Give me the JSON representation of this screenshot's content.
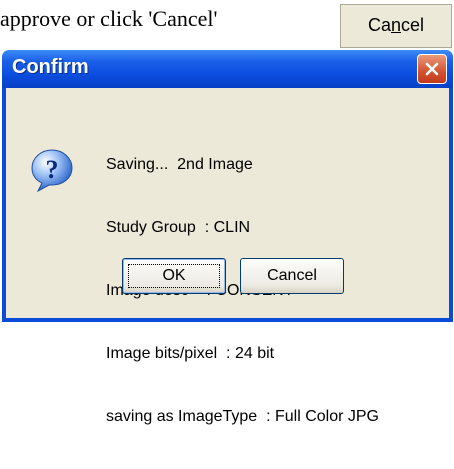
{
  "background": {
    "instruction_text": "approve or click 'Cancel'",
    "cancel_button_pre": "Ca",
    "cancel_button_underlined": "n",
    "cancel_button_post": "cel"
  },
  "dialog": {
    "title": "Confirm",
    "icon": "question-icon",
    "message_lines": [
      "Saving...  2nd Image",
      "Study Group  : CLIN",
      "Image desc    : CONSENT",
      "Image bits/pixel  : 24 bit",
      "saving as ImageType  : Full Color JPG"
    ],
    "ok_label": "OK",
    "cancel_label": "Cancel",
    "colors": {
      "titlebar": "#0a4bdc",
      "client": "#ece9d8",
      "close_button": "#d4512f"
    }
  }
}
